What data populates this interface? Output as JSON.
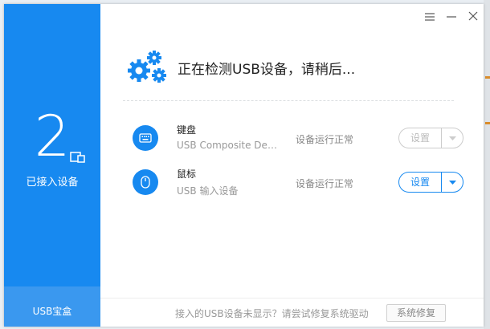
{
  "sidebar": {
    "device_count": "2",
    "connected_label": "已接入设备",
    "footer_label": "USB宝盒"
  },
  "header": {
    "status_text": "正在检测USB设备，请稍后..."
  },
  "devices": [
    {
      "icon": "keyboard-icon",
      "name": "键盘",
      "description": "USB Composite Device",
      "status": "设备运行正常",
      "button_label": "设置",
      "enabled": false
    },
    {
      "icon": "mouse-icon",
      "name": "鼠标",
      "description": "USB 输入设备",
      "status": "设备运行正常",
      "button_label": "设置",
      "enabled": true
    }
  ],
  "footer": {
    "hint_text": "接入的USB设备未显示？请尝试修复系统驱动",
    "repair_button_label": "系统修复"
  },
  "colors": {
    "accent": "#1789f0",
    "sidebar_footer": "#3a98ef",
    "disabled": "#cccccc"
  }
}
